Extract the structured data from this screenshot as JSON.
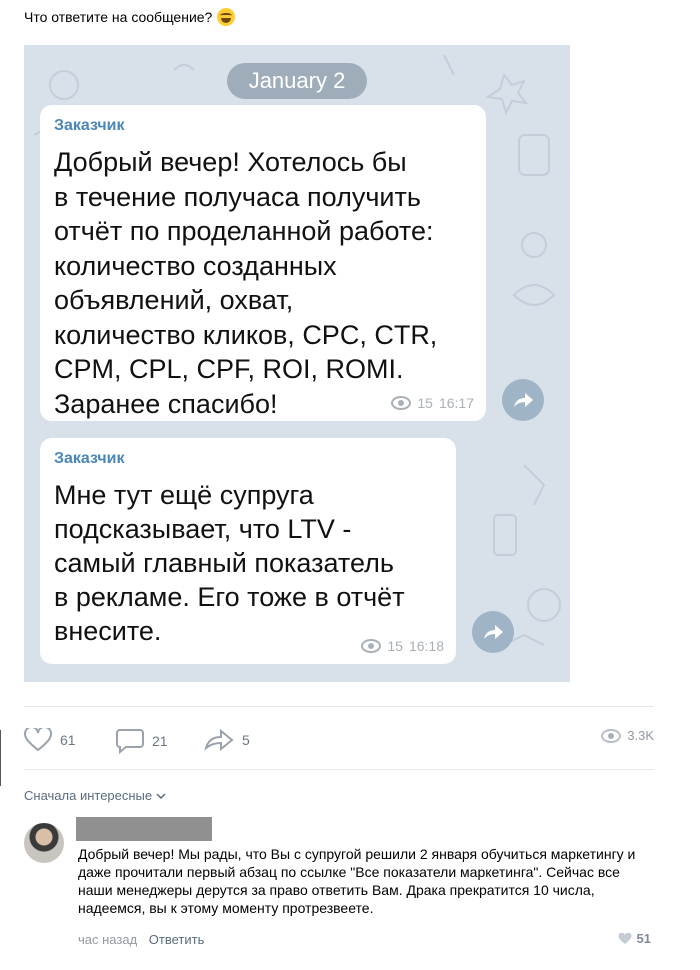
{
  "post": {
    "text": "Что ответите на сообщение?"
  },
  "screenshot": {
    "date_label": "January 2",
    "messages": [
      {
        "sender": "Заказчик",
        "text": "Добрый вечер! Хотелось бы\nв течение получаса получить\nотчёт по проделанной работе:\nколичество созданных\nобъявлений, охват,\nколичество кликов, CPC, CTR,\nCPM, CPL, CPF, ROI, ROMI.\nЗаранее спасибо!",
        "views": "15",
        "time": "16:17"
      },
      {
        "sender": "Заказчик",
        "text": "Мне тут ещё супруга\nподсказывает, что LTV  -\nсамый главный показатель\nв рекламе. Его тоже в отчёт\nвнесите.",
        "views": "15",
        "time": "16:18"
      }
    ]
  },
  "actions": {
    "likes": "61",
    "comments": "21",
    "shares": "5",
    "views": "3.3K"
  },
  "comments": {
    "sort_label": "Сначала интересные",
    "items": [
      {
        "text": "Добрый вечер! Мы рады, что Вы с супругой решили 2 января обучиться маркетингу и даже прочитали первый абзац по ссылке \"Все показатели маркетинга\". Сейчас все наши менеджеры дерутся за право ответить Вам. Драка прекратится 10 числа, надеемся, вы к этому моменту протрезвеете.",
        "time": "час назад",
        "reply_label": "Ответить",
        "likes": "51"
      }
    ]
  },
  "colors": {
    "chat_bg": "#d8e1ea",
    "sender": "#4a87b8",
    "link": "#5b6c80"
  }
}
